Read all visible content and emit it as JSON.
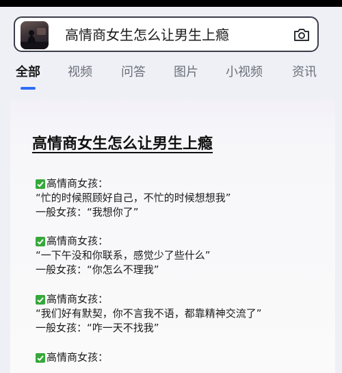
{
  "search": {
    "query": "高情商女生怎么让男生上瘾"
  },
  "tabs": [
    "全部",
    "视频",
    "问答",
    "图片",
    "小视频",
    "资讯"
  ],
  "active_tab": "全部",
  "accent_color": "#2f6cf5",
  "article": {
    "title": "高情商女生怎么让男生上瘾",
    "items": [
      {
        "heading": "高情商女孩：",
        "quote": "“忙的时候照顾好自己，不忙的时候想想我”",
        "normal": "一般女孩：“我想你了”"
      },
      {
        "heading": "高情商女孩：",
        "quote": "“一下午没和你联系，感觉少了些什么”",
        "normal": "一般女孩：“你怎么不理我”"
      },
      {
        "heading": "高情商女孩：",
        "quote": "“我们好有默契，你不言我不语，都靠精神交流了”",
        "normal": "一般女孩：“咋一天不找我”"
      },
      {
        "heading": "高情商女孩："
      }
    ]
  },
  "icons": {
    "camera": "camera-icon",
    "check": "check-mark-icon"
  }
}
